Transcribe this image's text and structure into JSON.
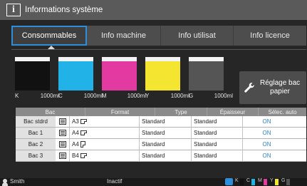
{
  "title": "Informations système",
  "tabs": [
    {
      "label": "Consommables",
      "active": true
    },
    {
      "label": "Info machine",
      "active": false
    },
    {
      "label": "Info utilisat",
      "active": false
    },
    {
      "label": "Info licence",
      "active": false
    }
  ],
  "inks": [
    {
      "code": "K",
      "amount": "1000ml",
      "color": "#111111",
      "level": 1.0
    },
    {
      "code": "C",
      "amount": "1000ml",
      "color": "#21b2e8",
      "level": 1.0
    },
    {
      "code": "M",
      "amount": "1000ml",
      "color": "#e23aa0",
      "level": 1.0
    },
    {
      "code": "Y",
      "amount": "1000ml",
      "color": "#f4e531",
      "level": 1.0
    },
    {
      "code": "G",
      "amount": "1000ml",
      "color": "#555555",
      "level": 1.0
    }
  ],
  "adjust_button": {
    "line1": "Réglage bac",
    "line2": "papier"
  },
  "table": {
    "headers": [
      "Bac",
      "Format",
      "Type",
      "Épaisseur",
      "Sélec. auto"
    ],
    "rows": [
      {
        "tray": "Bac stdrd",
        "format": "A3",
        "orientation": "landscape",
        "type": "Standard",
        "thickness": "Standard",
        "auto": "ON"
      },
      {
        "tray": "Bac 1",
        "format": "A4",
        "orientation": "landscape",
        "type": "Standard",
        "thickness": "Standard",
        "auto": "ON"
      },
      {
        "tray": "Bac 2",
        "format": "A4",
        "orientation": "portrait",
        "type": "Standard",
        "thickness": "Standard",
        "auto": "ON"
      },
      {
        "tray": "Bac 3",
        "format": "B4",
        "orientation": "landscape",
        "type": "Standard",
        "thickness": "Standard",
        "auto": "ON"
      }
    ]
  },
  "status": {
    "user": "Smith",
    "state": "Inactif",
    "mini_labels": [
      "K",
      "C",
      "M",
      "Y",
      "G"
    ]
  },
  "colors": {
    "accent": "#2d8fdc",
    "on": "#2d7fd6"
  }
}
